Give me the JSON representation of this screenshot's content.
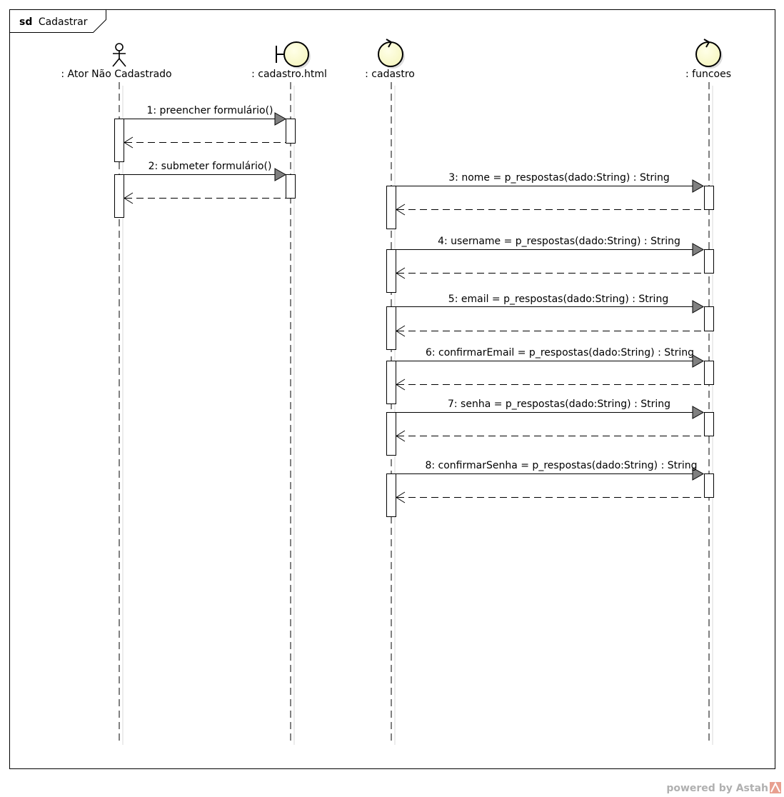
{
  "frame": {
    "keyword": "sd",
    "name": "Cadastrar"
  },
  "lifelines": [
    {
      "id": "ator",
      "kind": "actor",
      "label": ": Ator Não Cadastrado",
      "icon": "actor-icon"
    },
    {
      "id": "html",
      "kind": "boundary",
      "label": ": cadastro.html",
      "icon": "boundary-icon"
    },
    {
      "id": "cadastro",
      "kind": "control",
      "label": ": cadastro",
      "icon": "control-icon"
    },
    {
      "id": "funcoes",
      "kind": "control",
      "label": ": funcoes",
      "icon": "control-icon"
    }
  ],
  "messages": [
    {
      "from": "ator",
      "to": "html",
      "text": "1: preencher formulário()"
    },
    {
      "from": "ator",
      "to": "html",
      "text": "2: submeter formulário()"
    },
    {
      "from": "cadastro",
      "to": "funcoes",
      "text": "3: nome = p_respostas(dado:String) : String"
    },
    {
      "from": "cadastro",
      "to": "funcoes",
      "text": "4: username = p_respostas(dado:String) : String"
    },
    {
      "from": "cadastro",
      "to": "funcoes",
      "text": "5: email = p_respostas(dado:String) : String"
    },
    {
      "from": "cadastro",
      "to": "funcoes",
      "text": "6: confirmarEmail = p_respostas(dado:String) : String"
    },
    {
      "from": "cadastro",
      "to": "funcoes",
      "text": "7: senha = p_respostas(dado:String) : String"
    },
    {
      "from": "cadastro",
      "to": "funcoes",
      "text": "8: confirmarSenha = p_respostas(dado:String) : String"
    }
  ],
  "colors": {
    "icon_fill": "#fefed2",
    "arrow_fill": "#808080",
    "line": "#000000",
    "lifeline_shadow": "#d8d8d8"
  },
  "watermark": "powered by Astah"
}
